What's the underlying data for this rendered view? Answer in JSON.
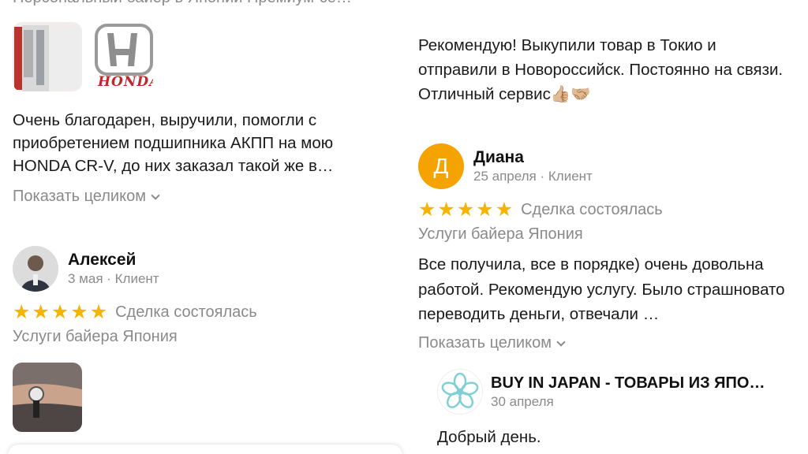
{
  "top_cut_title": "Персональный байер в Японии Премиум-се…",
  "review1": {
    "text": "Очень благодарен, выручили, помогли с приобретением подшипника АКПП на мою HONDA CR-V, до них заказал такой же в…",
    "show_more": "Показать целиком",
    "honda_logo": "HONDA"
  },
  "review2": {
    "author": "Алексей",
    "meta": "3 мая · Клиент",
    "stars": 5,
    "deal_status": "Сделка состоялась",
    "service": "Услуги байера Япония"
  },
  "review_right_top": {
    "text": "Рекомендую! Выкупили товар в Токио и отправили в Новороссийск. Постоянно на связи. Отличный сервис👍🏼🤝🏼"
  },
  "review3": {
    "avatar_letter": "Д",
    "author": "Диана",
    "meta": "25 апреля · Клиент",
    "stars": 5,
    "deal_status": "Сделка состоялась",
    "service": "Услуги байера Япония",
    "text": "Все получила, все в порядке) очень довольна работой. Рекомендую услугу. Было страшновато переводить деньги, отвечали …",
    "show_more": "Показать целиком"
  },
  "seller_reply": {
    "name": "BUY IN JAPAN - ТОВАРЫ ИЗ ЯПО…",
    "date": "30 апреля",
    "text": "Добрый день."
  },
  "colors": {
    "star": "#f5b400",
    "avatar_orange": "#f5a300",
    "muted_text": "#8a8a8a",
    "seller_logo": "#7ed0d6"
  }
}
